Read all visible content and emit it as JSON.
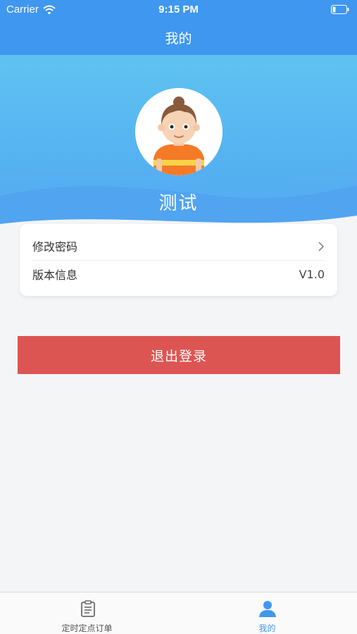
{
  "status_bar": {
    "carrier": "Carrier",
    "time": "9:15 PM",
    "icons": [
      "wifi-icon",
      "battery-icon"
    ]
  },
  "nav": {
    "title": "我的"
  },
  "profile": {
    "avatar_icon": "child-avatar-icon",
    "username": "测试"
  },
  "settings": {
    "change_password_label": "修改密码",
    "version_label": "版本信息",
    "version_value": "V1.0"
  },
  "actions": {
    "logout_label": "退出登录"
  },
  "tab_bar": {
    "tabs": [
      {
        "label": "定时定点订单",
        "icon": "clipboard-icon",
        "active": false
      },
      {
        "label": "我的",
        "icon": "person-icon",
        "active": true
      }
    ]
  },
  "colors": {
    "brand_blue": "#3f97ef",
    "logout_red": "#dc5553",
    "background": "#f4f5f7"
  }
}
